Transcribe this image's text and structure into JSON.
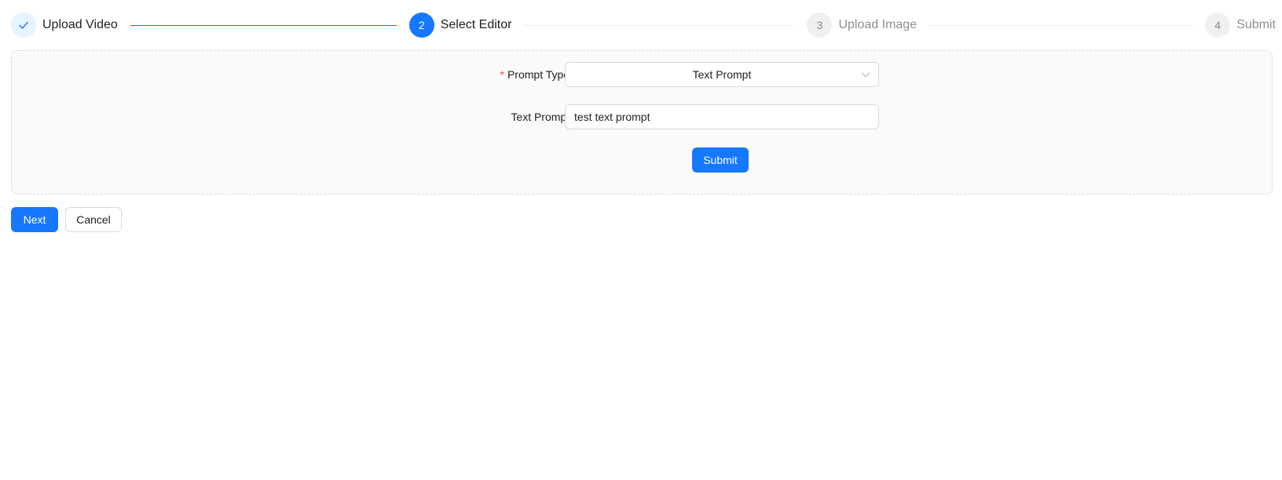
{
  "steps": [
    {
      "status": "finish",
      "icon": "check-icon",
      "number": "",
      "title": "Upload Video"
    },
    {
      "status": "process",
      "number": "2",
      "title": "Select Editor"
    },
    {
      "status": "wait",
      "number": "3",
      "title": "Upload Image"
    },
    {
      "status": "wait",
      "number": "4",
      "title": "Submit"
    }
  ],
  "form": {
    "prompt_type": {
      "required_mark": "*",
      "label": "Prompt Type:",
      "value": "Text Prompt",
      "arrow_icon": "chevron-down-icon"
    },
    "text_prompt": {
      "label": "Text Prompt:",
      "value": "test text prompt"
    },
    "submit_label": "Submit"
  },
  "actions": {
    "next_label": "Next",
    "cancel_label": "Cancel"
  },
  "colors": {
    "primary": "#1677ff",
    "finish_bg": "#e6f4ff",
    "required": "#ff4d4f",
    "panel_bg": "#fafafa"
  }
}
